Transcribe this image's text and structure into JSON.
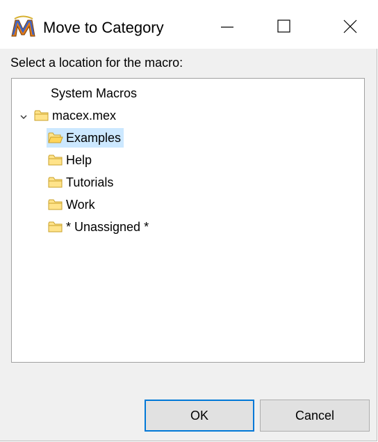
{
  "window": {
    "title": "Move to Category",
    "app_icon": "macro-express-m-icon",
    "controls": {
      "minimize_icon": "minimize-icon",
      "maximize_icon": "maximize-icon",
      "close_icon": "close-icon"
    }
  },
  "prompt": "Select a location for the macro:",
  "tree": {
    "root_label": "System Macros",
    "file": {
      "label": "macex.mex",
      "expanded": true,
      "icon": "folder-icon"
    },
    "items": [
      {
        "label": "Examples",
        "selected": true,
        "icon": "folder-open-icon"
      },
      {
        "label": "Help",
        "selected": false,
        "icon": "folder-icon"
      },
      {
        "label": "Tutorials",
        "selected": false,
        "icon": "folder-icon"
      },
      {
        "label": "Work",
        "selected": false,
        "icon": "folder-icon"
      },
      {
        "label": "* Unassigned *",
        "selected": false,
        "icon": "folder-icon"
      }
    ]
  },
  "buttons": {
    "ok_label": "OK",
    "cancel_label": "Cancel"
  },
  "colors": {
    "selection": "#cce8ff",
    "default_button_border": "#0078d7",
    "folder_fill": "#ffe38a",
    "folder_stroke": "#c9a02a"
  }
}
